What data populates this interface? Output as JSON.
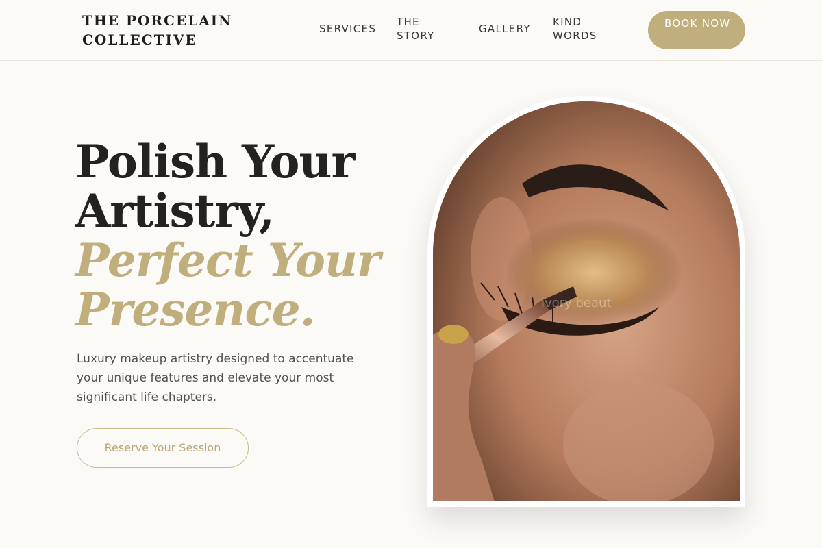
{
  "header": {
    "brand": "THE PORCELAIN COLLECTIVE",
    "nav": {
      "services": "SERVICES",
      "story": "THE STORY",
      "gallery": "GALLERY",
      "kind_words": "KIND WORDS"
    },
    "book_button": "BOOK NOW"
  },
  "hero": {
    "title_line1": "Polish Your",
    "title_line2": "Artistry,",
    "title_line3": "Perfect Your",
    "title_line4": "Presence.",
    "subtitle": "Luxury makeup artistry designed to accentuate your unique features and elevate your most significant life chapters.",
    "cta": "Reserve Your Session",
    "image_watermark": "ivory beaut"
  },
  "colors": {
    "accent": "#c0ae7c",
    "background": "#fbfaf6",
    "text": "#24221f"
  }
}
